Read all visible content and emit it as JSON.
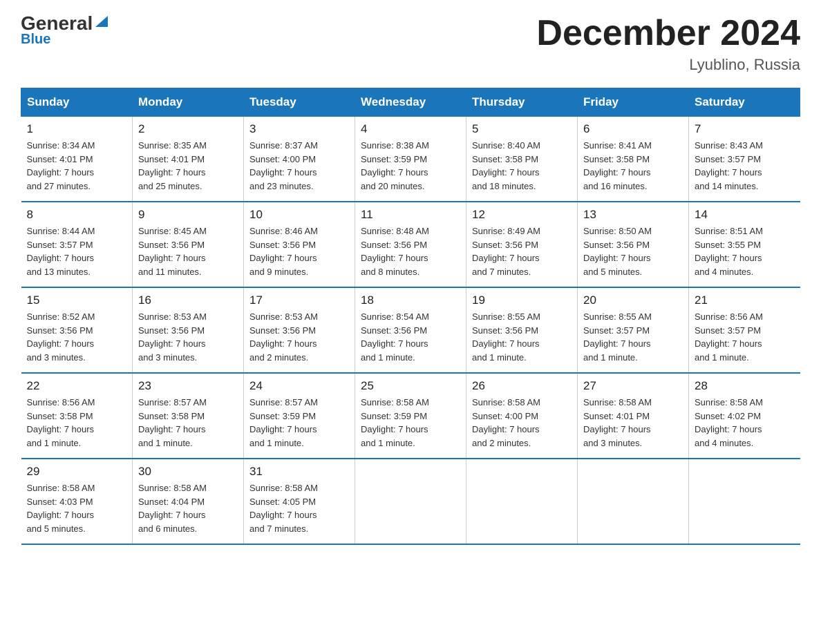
{
  "logo": {
    "general": "General",
    "blue": "Blue"
  },
  "title": "December 2024",
  "location": "Lyublino, Russia",
  "days_of_week": [
    "Sunday",
    "Monday",
    "Tuesday",
    "Wednesday",
    "Thursday",
    "Friday",
    "Saturday"
  ],
  "weeks": [
    [
      {
        "day": "1",
        "sunrise": "8:34 AM",
        "sunset": "4:01 PM",
        "daylight": "7 hours and 27 minutes."
      },
      {
        "day": "2",
        "sunrise": "8:35 AM",
        "sunset": "4:01 PM",
        "daylight": "7 hours and 25 minutes."
      },
      {
        "day": "3",
        "sunrise": "8:37 AM",
        "sunset": "4:00 PM",
        "daylight": "7 hours and 23 minutes."
      },
      {
        "day": "4",
        "sunrise": "8:38 AM",
        "sunset": "3:59 PM",
        "daylight": "7 hours and 20 minutes."
      },
      {
        "day": "5",
        "sunrise": "8:40 AM",
        "sunset": "3:58 PM",
        "daylight": "7 hours and 18 minutes."
      },
      {
        "day": "6",
        "sunrise": "8:41 AM",
        "sunset": "3:58 PM",
        "daylight": "7 hours and 16 minutes."
      },
      {
        "day": "7",
        "sunrise": "8:43 AM",
        "sunset": "3:57 PM",
        "daylight": "7 hours and 14 minutes."
      }
    ],
    [
      {
        "day": "8",
        "sunrise": "8:44 AM",
        "sunset": "3:57 PM",
        "daylight": "7 hours and 13 minutes."
      },
      {
        "day": "9",
        "sunrise": "8:45 AM",
        "sunset": "3:56 PM",
        "daylight": "7 hours and 11 minutes."
      },
      {
        "day": "10",
        "sunrise": "8:46 AM",
        "sunset": "3:56 PM",
        "daylight": "7 hours and 9 minutes."
      },
      {
        "day": "11",
        "sunrise": "8:48 AM",
        "sunset": "3:56 PM",
        "daylight": "7 hours and 8 minutes."
      },
      {
        "day": "12",
        "sunrise": "8:49 AM",
        "sunset": "3:56 PM",
        "daylight": "7 hours and 7 minutes."
      },
      {
        "day": "13",
        "sunrise": "8:50 AM",
        "sunset": "3:56 PM",
        "daylight": "7 hours and 5 minutes."
      },
      {
        "day": "14",
        "sunrise": "8:51 AM",
        "sunset": "3:55 PM",
        "daylight": "7 hours and 4 minutes."
      }
    ],
    [
      {
        "day": "15",
        "sunrise": "8:52 AM",
        "sunset": "3:56 PM",
        "daylight": "7 hours and 3 minutes."
      },
      {
        "day": "16",
        "sunrise": "8:53 AM",
        "sunset": "3:56 PM",
        "daylight": "7 hours and 3 minutes."
      },
      {
        "day": "17",
        "sunrise": "8:53 AM",
        "sunset": "3:56 PM",
        "daylight": "7 hours and 2 minutes."
      },
      {
        "day": "18",
        "sunrise": "8:54 AM",
        "sunset": "3:56 PM",
        "daylight": "7 hours and 1 minute."
      },
      {
        "day": "19",
        "sunrise": "8:55 AM",
        "sunset": "3:56 PM",
        "daylight": "7 hours and 1 minute."
      },
      {
        "day": "20",
        "sunrise": "8:55 AM",
        "sunset": "3:57 PM",
        "daylight": "7 hours and 1 minute."
      },
      {
        "day": "21",
        "sunrise": "8:56 AM",
        "sunset": "3:57 PM",
        "daylight": "7 hours and 1 minute."
      }
    ],
    [
      {
        "day": "22",
        "sunrise": "8:56 AM",
        "sunset": "3:58 PM",
        "daylight": "7 hours and 1 minute."
      },
      {
        "day": "23",
        "sunrise": "8:57 AM",
        "sunset": "3:58 PM",
        "daylight": "7 hours and 1 minute."
      },
      {
        "day": "24",
        "sunrise": "8:57 AM",
        "sunset": "3:59 PM",
        "daylight": "7 hours and 1 minute."
      },
      {
        "day": "25",
        "sunrise": "8:58 AM",
        "sunset": "3:59 PM",
        "daylight": "7 hours and 1 minute."
      },
      {
        "day": "26",
        "sunrise": "8:58 AM",
        "sunset": "4:00 PM",
        "daylight": "7 hours and 2 minutes."
      },
      {
        "day": "27",
        "sunrise": "8:58 AM",
        "sunset": "4:01 PM",
        "daylight": "7 hours and 3 minutes."
      },
      {
        "day": "28",
        "sunrise": "8:58 AM",
        "sunset": "4:02 PM",
        "daylight": "7 hours and 4 minutes."
      }
    ],
    [
      {
        "day": "29",
        "sunrise": "8:58 AM",
        "sunset": "4:03 PM",
        "daylight": "7 hours and 5 minutes."
      },
      {
        "day": "30",
        "sunrise": "8:58 AM",
        "sunset": "4:04 PM",
        "daylight": "7 hours and 6 minutes."
      },
      {
        "day": "31",
        "sunrise": "8:58 AM",
        "sunset": "4:05 PM",
        "daylight": "7 hours and 7 minutes."
      },
      null,
      null,
      null,
      null
    ]
  ],
  "labels": {
    "sunrise": "Sunrise:",
    "sunset": "Sunset:",
    "daylight": "Daylight:"
  }
}
